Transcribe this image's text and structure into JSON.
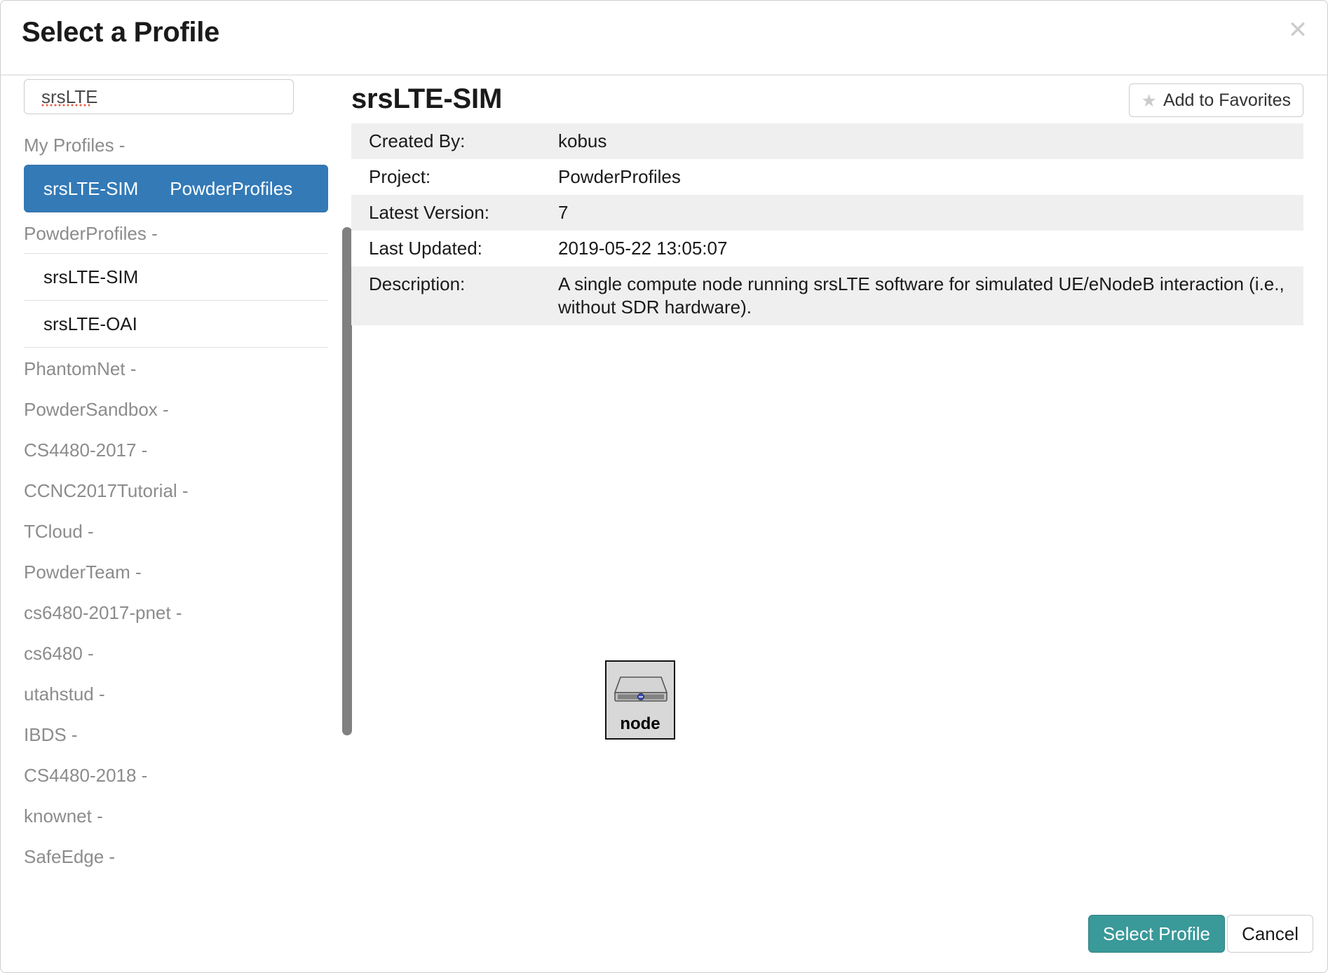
{
  "modal": {
    "title": "Select a Profile",
    "close_icon": "close-icon",
    "close_glyph": "✕"
  },
  "search": {
    "value": "srsLTE",
    "placeholder": "",
    "misspelled": true
  },
  "sidebar": {
    "groups": [
      {
        "header": "My Profiles -",
        "items": [
          {
            "name": "srsLTE-SIM",
            "project": "PowderProfiles",
            "selected": true
          }
        ]
      },
      {
        "header": "PowderProfiles -",
        "items": [
          {
            "name": "srsLTE-SIM",
            "project": "",
            "selected": false
          },
          {
            "name": "srsLTE-OAI",
            "project": "",
            "selected": false
          }
        ]
      },
      {
        "header": "PhantomNet -",
        "items": []
      },
      {
        "header": "PowderSandbox -",
        "items": []
      },
      {
        "header": "CS4480-2017 -",
        "items": []
      },
      {
        "header": "CCNC2017Tutorial -",
        "items": []
      },
      {
        "header": "TCloud -",
        "items": []
      },
      {
        "header": "PowderTeam -",
        "items": []
      },
      {
        "header": "cs6480-2017-pnet -",
        "items": []
      },
      {
        "header": "cs6480 -",
        "items": []
      },
      {
        "header": "utahstud -",
        "items": []
      },
      {
        "header": "IBDS -",
        "items": []
      },
      {
        "header": "CS4480-2018 -",
        "items": []
      },
      {
        "header": "knownet -",
        "items": []
      },
      {
        "header": "SafeEdge -",
        "items": []
      }
    ]
  },
  "detail": {
    "title": "srsLTE-SIM",
    "favorites_label": "Add to Favorites",
    "favorites_star_glyph": "★",
    "rows": [
      {
        "label": "Created By:",
        "value": "kobus"
      },
      {
        "label": "Project:",
        "value": "PowderProfiles"
      },
      {
        "label": "Latest Version:",
        "value": "7"
      },
      {
        "label": "Last Updated:",
        "value": "2019-05-22 13:05:07"
      },
      {
        "label": "Description:",
        "value": "A single compute node running srsLTE software for simulated UE/eNodeB interaction (i.e., without SDR hardware)."
      }
    ]
  },
  "topology": {
    "nodes": [
      {
        "label": "node",
        "icon": "server-node-icon"
      }
    ]
  },
  "footer": {
    "select_label": "Select Profile",
    "cancel_label": "Cancel"
  },
  "colors": {
    "selected_row": "#337ab7",
    "primary_button": "#3a9999",
    "table_stripe": "#efefef",
    "muted_text": "#8c8c8c",
    "scrollbar_thumb": "#808080",
    "spellcheck_underline": "#e8604c"
  }
}
